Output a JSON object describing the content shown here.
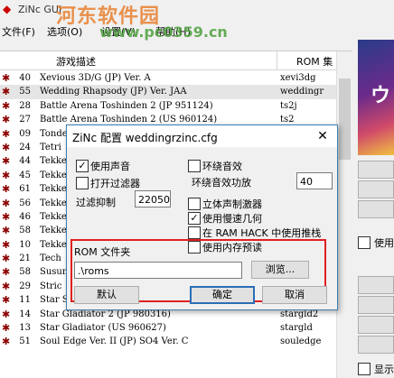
{
  "app": {
    "title": "ZiNc GUI"
  },
  "watermark": {
    "brand": "河东软件园",
    "url": "www.pc0359.cn"
  },
  "menu": [
    {
      "label": "文件(F)"
    },
    {
      "label": "选项(O)"
    },
    {
      "label": "设置(V)"
    },
    {
      "label": "帮助(H)"
    }
  ],
  "list": {
    "col_desc": "游戏描述",
    "col_rom": "ROM 集",
    "rows": [
      {
        "num": "40",
        "desc": "Xevious 3D/G (JP) Ver. A",
        "rom": "xevi3dg"
      },
      {
        "num": "55",
        "desc": "Wedding Rhapsody (JP) Ver. JAA",
        "rom": "weddingr"
      },
      {
        "num": "28",
        "desc": "Battle Arena Toshinden 2 (JP 951124)",
        "rom": "ts2j"
      },
      {
        "num": "27",
        "desc": "Battle Arena Toshinden 2 (US 960124)",
        "rom": "ts2"
      },
      {
        "num": "09",
        "desc": "Tondemo",
        "rom": ""
      },
      {
        "num": "24",
        "desc": "Tetri",
        "rom": ""
      },
      {
        "num": "44",
        "desc": "Tekke",
        "rom": ""
      },
      {
        "num": "45",
        "desc": "Tekke",
        "rom": ""
      },
      {
        "num": "61",
        "desc": "Tekke",
        "rom": ""
      },
      {
        "num": "56",
        "desc": "Tekke",
        "rom": ""
      },
      {
        "num": "46",
        "desc": "Tekke",
        "rom": ""
      },
      {
        "num": "58",
        "desc": "Tekke",
        "rom": ""
      },
      {
        "num": "10",
        "desc": "Tekke",
        "rom": ""
      },
      {
        "num": "21",
        "desc": "Tech",
        "rom": ""
      },
      {
        "num": "58",
        "desc": "Susum",
        "rom": ""
      },
      {
        "num": "29",
        "desc": "Stric",
        "rom": ""
      },
      {
        "num": "11",
        "desc": "Star Sweep (JP) Ver. A",
        "rom": "starswep"
      },
      {
        "num": "14",
        "desc": "Star Gladiator 2 (JP 980316)",
        "rom": "stargld2"
      },
      {
        "num": "13",
        "desc": "Star Gladiator (US 960627)",
        "rom": "stargld"
      },
      {
        "num": "51",
        "desc": "Soul Edge Ver. II (JP) SO4 Ver. C",
        "rom": "souledge"
      }
    ]
  },
  "right_panel": {
    "checkbox_label": "使用",
    "checkbox2_label": "显示"
  },
  "dialog": {
    "title": "ZiNc 配置 weddingrzinc.cfg",
    "close": "✕",
    "use_sound": {
      "label": "使用声音",
      "checked": true
    },
    "enable_filter": {
      "label": "打开过滤器",
      "checked": false
    },
    "filter_suppress": {
      "label": "过滤抑制",
      "value": "22050"
    },
    "reverb": {
      "label": "环绕音效",
      "checked": false
    },
    "reverb_power": {
      "label": "环绕音效功放",
      "value": "40"
    },
    "stereo_exciter": {
      "label": "立体声制激器",
      "checked": false
    },
    "slow_geometry": {
      "label": "使用慢速几何",
      "checked": true
    },
    "ram_hack": {
      "label": "在 RAM HACK 中使用推栈",
      "checked": false
    },
    "memory_preload": {
      "label": "使用内存预读",
      "checked": false
    },
    "rom_folder": {
      "label": "ROM 文件夹",
      "value": ".\\roms"
    },
    "browse": "浏览...",
    "default": "默认",
    "ok": "确定",
    "cancel": "取消"
  }
}
